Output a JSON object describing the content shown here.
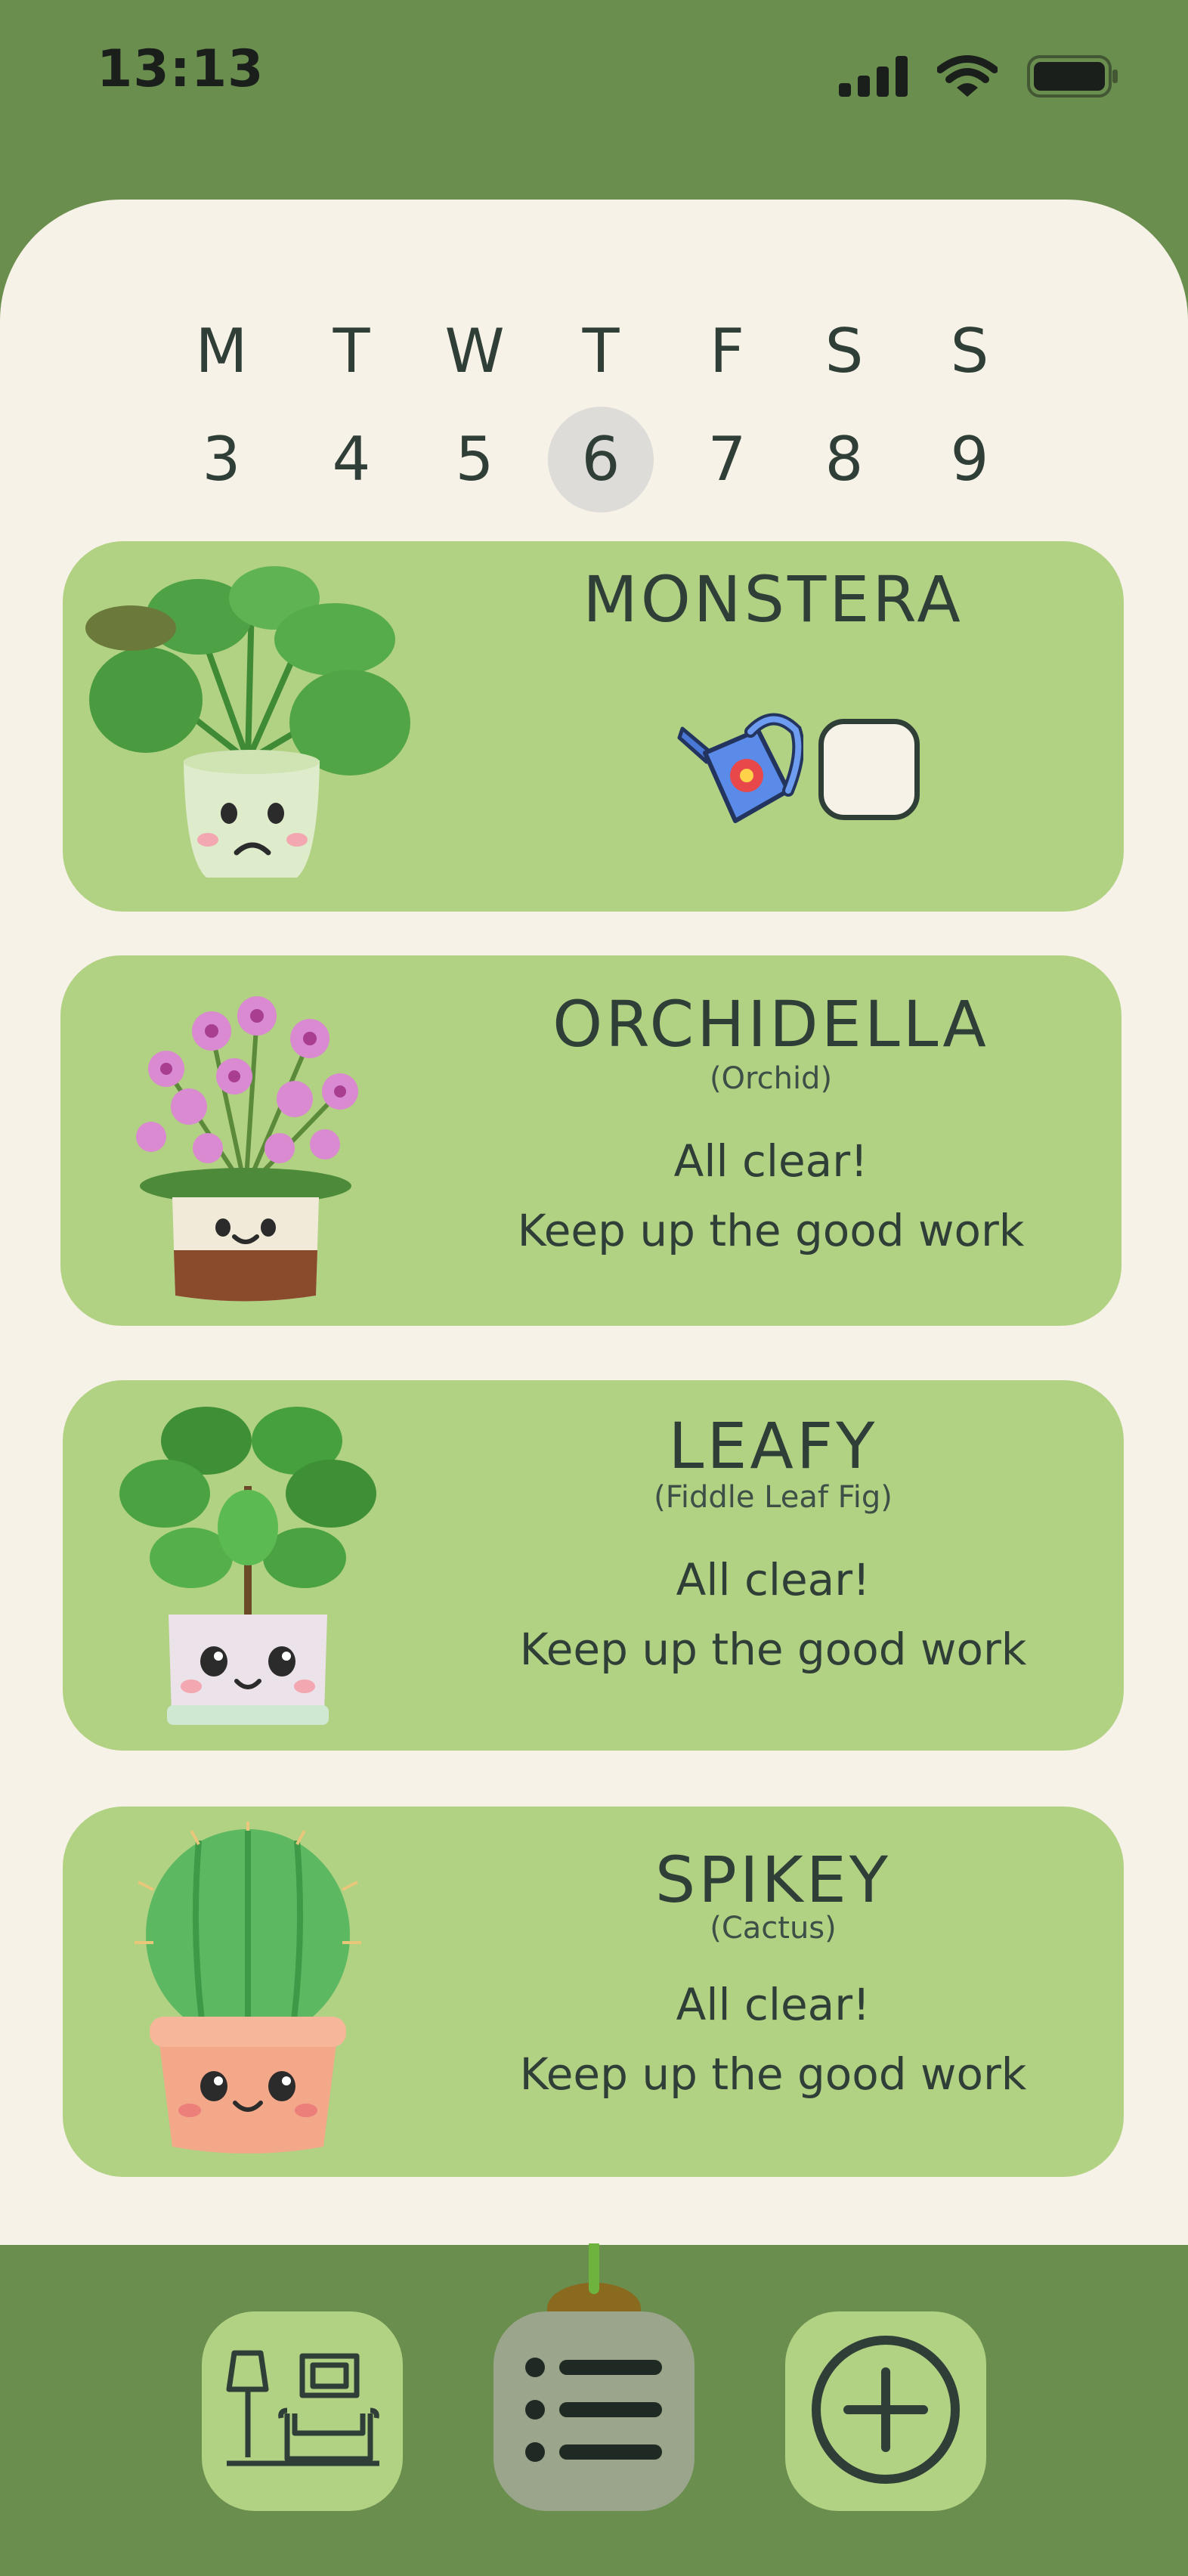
{
  "status_bar": {
    "time": "13:13",
    "icons": [
      "cellular-signal-icon",
      "wifi-icon",
      "battery-icon"
    ]
  },
  "week": {
    "days": [
      {
        "letter": "M",
        "number": "3"
      },
      {
        "letter": "T",
        "number": "4"
      },
      {
        "letter": "W",
        "number": "5"
      },
      {
        "letter": "T",
        "number": "6",
        "today": true
      },
      {
        "letter": "F",
        "number": "7"
      },
      {
        "letter": "S",
        "number": "8"
      },
      {
        "letter": "S",
        "number": "9"
      }
    ]
  },
  "plants": [
    {
      "name": "MONSTERA",
      "species": "",
      "mood": "sad",
      "task": {
        "icon": "watering-can-icon",
        "done": false
      }
    },
    {
      "name": "ORCHIDELLA",
      "species": "(Orchid)",
      "mood": "happy",
      "status_title": "All clear!",
      "status_message": "Keep up the good work"
    },
    {
      "name": "LEAFY",
      "species": "(Fiddle Leaf Fig)",
      "mood": "happy",
      "status_title": "All clear!",
      "status_message": "Keep up the good work"
    },
    {
      "name": "SPIKEY",
      "species": "(Cactus)",
      "mood": "happy",
      "status_title": "All clear!",
      "status_message": "Keep up the good work"
    }
  ],
  "bottom_nav": [
    {
      "icon": "living-room-icon",
      "active": false
    },
    {
      "icon": "list-icon",
      "active": true
    },
    {
      "icon": "add-circle-icon",
      "active": false
    }
  ],
  "colors": {
    "header_green": "#6a8e4e",
    "panel_cream": "#f7f2e7",
    "card_green": "#b1d183",
    "text_dark": "#2f3e37",
    "nav_active": "#9aa58c"
  }
}
